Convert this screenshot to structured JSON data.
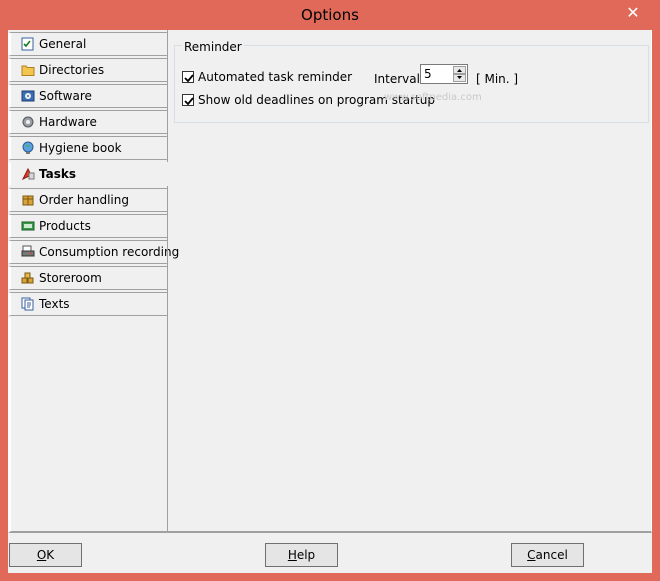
{
  "window": {
    "title": "Options",
    "close_glyph": "✕"
  },
  "tabs": [
    {
      "label": "General",
      "icon": "checklist-icon"
    },
    {
      "label": "Directories",
      "icon": "folder-icon"
    },
    {
      "label": "Software",
      "icon": "software-icon"
    },
    {
      "label": "Hardware",
      "icon": "gear-icon"
    },
    {
      "label": "Hygiene book",
      "icon": "globe-icon"
    },
    {
      "label": "Tasks",
      "icon": "tasks-icon",
      "active": true
    },
    {
      "label": "Order handling",
      "icon": "package-icon"
    },
    {
      "label": "Products",
      "icon": "product-icon"
    },
    {
      "label": "Consumption recording",
      "icon": "printer-icon"
    },
    {
      "label": "Storeroom",
      "icon": "storeroom-icon"
    },
    {
      "label": "Texts",
      "icon": "documents-icon"
    }
  ],
  "reminder": {
    "group_title": "Reminder",
    "automated_task_reminder": {
      "label": "Automated task reminder",
      "checked": true
    },
    "show_old_deadlines": {
      "label": "Show old deadlines on program startup",
      "checked": true
    },
    "interval_label": "Interval",
    "interval_value": "5",
    "unit_label": "[ Min. ]"
  },
  "watermark": "www.softpedia.com",
  "buttons": {
    "ok": {
      "accel": "O",
      "rest": "K"
    },
    "help": {
      "accel": "H",
      "rest": "elp"
    },
    "cancel": {
      "accel": "C",
      "rest": "ancel"
    }
  }
}
